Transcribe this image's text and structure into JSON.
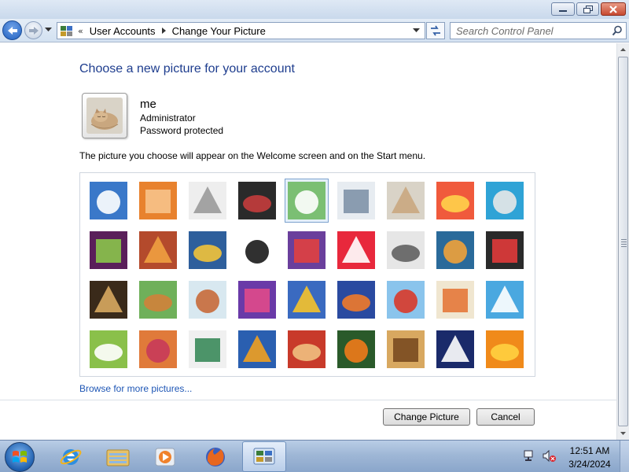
{
  "window": {
    "minimize_icon": "minimize-icon",
    "maximize_icon": "restore-icon",
    "close_icon": "close-icon"
  },
  "navbar": {
    "back_icon": "back-arrow-icon",
    "forward_icon": "forward-arrow-icon",
    "breadcrumbs": [
      "User Accounts",
      "Change Your Picture"
    ],
    "overflow_chevron": "«",
    "search_placeholder": "Search Control Panel"
  },
  "main": {
    "heading": "Choose a new picture for your account",
    "account": {
      "name": "me",
      "role": "Administrator",
      "status": "Password protected"
    },
    "description": "The picture you choose will appear on the Welcome screen and on the Start menu.",
    "pictures": [
      "roller-coaster",
      "starfish",
      "robot-toy",
      "record-player",
      "lucky-cat",
      "gyroscope",
      "sleeping-kitten",
      "flower",
      "pinwheel",
      "ball",
      "fabric",
      "leaf",
      "dog",
      "crayons",
      "star-pattern",
      "jacks",
      "stairs",
      "paper-crane",
      "guitar",
      "puppy",
      "robot",
      "scarf",
      "sunflower",
      "fish",
      "hot-air-balloon",
      "doll",
      "sailboat",
      "soccer-ball",
      "fabric-stripes",
      "marbles",
      "window",
      "weaving",
      "butterfly",
      "basket",
      "lighthouse",
      "daisy"
    ],
    "selected_index": 4,
    "browse_link": "Browse for more pictures...",
    "buttons": {
      "change": "Change Picture",
      "cancel": "Cancel"
    }
  },
  "taskbar": {
    "apps": [
      "start-orb",
      "internet-explorer",
      "windows-explorer",
      "media-player",
      "firefox",
      "control-panel"
    ],
    "time": "12:51 AM",
    "date": "3/24/2024"
  },
  "colors": {
    "heading": "#1e3d8e",
    "link": "#1e56b5",
    "selection": "#7da2ce"
  }
}
